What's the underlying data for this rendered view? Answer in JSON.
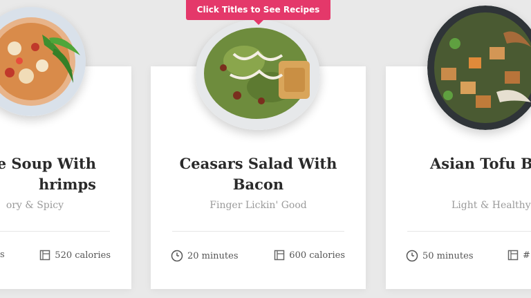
{
  "tooltip": {
    "text": "Click Titles to See Recipes"
  },
  "cards": [
    {
      "title": "e Soup With\nhrimps",
      "subtitle": "ory & Spicy",
      "time": "s",
      "calories": "520 calories"
    },
    {
      "title": "Ceasars Salad With\nBacon",
      "subtitle": "Finger Lickin' Good",
      "time": "20 minutes",
      "calories": "600 calories"
    },
    {
      "title": "Asian Tofu Bo",
      "subtitle": "Light & Healthy",
      "time": "50 minutes",
      "calories": "#"
    }
  ]
}
